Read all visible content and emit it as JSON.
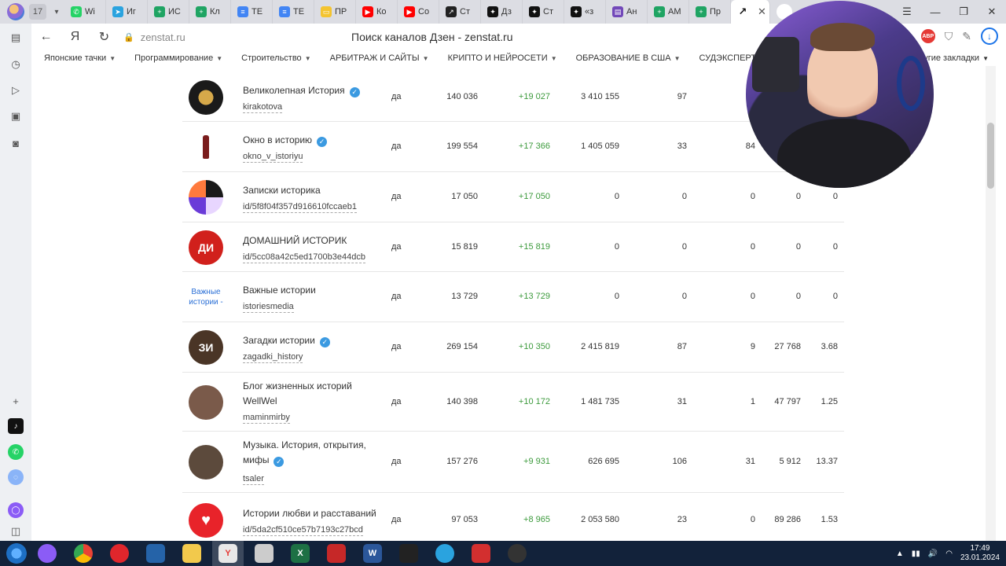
{
  "browser": {
    "tab_count": "17",
    "tabs": [
      {
        "label": "Wi",
        "icon": "whatsapp-icon",
        "color": "#25d366"
      },
      {
        "label": "Иг",
        "icon": "telegram-icon",
        "color": "#2aa3df"
      },
      {
        "label": "ИС",
        "icon": "google-sheets-icon",
        "color": "#1fa463"
      },
      {
        "label": "Кл",
        "icon": "google-sheets-icon",
        "color": "#1fa463"
      },
      {
        "label": "ТЕ",
        "icon": "google-docs-icon",
        "color": "#4285f4"
      },
      {
        "label": "ТЕ",
        "icon": "google-docs-icon",
        "color": "#4285f4"
      },
      {
        "label": "ПР",
        "icon": "folder-icon",
        "color": "#f4c430"
      },
      {
        "label": "Ко",
        "icon": "youtube-icon",
        "color": "#ff0000"
      },
      {
        "label": "Со",
        "icon": "youtube-icon",
        "color": "#ff0000"
      },
      {
        "label": "Ст",
        "icon": "zenstat-icon",
        "color": "#222222"
      },
      {
        "label": "Дз",
        "icon": "dzen-icon",
        "color": "#111111"
      },
      {
        "label": "Ст",
        "icon": "dzen-icon",
        "color": "#111111"
      },
      {
        "label": "«з",
        "icon": "dzen-icon",
        "color": "#111111"
      },
      {
        "label": "Ан",
        "icon": "forms-icon",
        "color": "#7248b9"
      },
      {
        "label": "АМ",
        "icon": "google-sheets-icon",
        "color": "#1fa463"
      },
      {
        "label": "Пр",
        "icon": "google-sheets-icon",
        "color": "#1fa463"
      }
    ],
    "active_tab_icon": "zenstat-icon",
    "url": "zenstat.ru",
    "page_title": "Поиск каналов Дзен - zenstat.ru",
    "abp_label": "ABP"
  },
  "bookmarks": {
    "items": [
      "Японские тачки",
      "Программирование",
      "Строительство",
      "АРБИТРАЖ И САЙТЫ",
      "КРИПТО И НЕЙРОСЕТИ",
      "ОБРАЗОВАНИЕ В США",
      "СУДЭКСПЕРТИЗА",
      "Всякое"
    ],
    "other": "Другие закладки"
  },
  "channels": [
    {
      "name": "Великолепная История",
      "verified": true,
      "slug": "kirakotova",
      "active": "да",
      "subs": "140 036",
      "growth": "+19 027",
      "views": "3 410 155",
      "pubs": "97",
      "f6": "",
      "f7": "",
      "f8": "",
      "avatar": {
        "icon": "double-headed-eagle-icon",
        "bg": "#1a1a1a",
        "text": ""
      }
    },
    {
      "name": "Окно в историю",
      "verified": true,
      "slug": "okno_v_istoriyu",
      "active": "да",
      "subs": "199 554",
      "growth": "+17 366",
      "views": "1 405 059",
      "pubs": "33",
      "f6": "84",
      "f7": "",
      "f8": "",
      "avatar": {
        "icon": "bottle-icon",
        "bg": "#ffffff",
        "text": ""
      }
    },
    {
      "name": "Записки историка",
      "verified": false,
      "slug": "id/5f8f04f357d916610fccaeb1",
      "active": "да",
      "subs": "17 050",
      "growth": "+17 050",
      "views": "0",
      "pubs": "0",
      "f6": "0",
      "f7": "0",
      "f8": "0",
      "avatar": {
        "icon": "abstract-avatar-icon",
        "bg": "#6a3bd8",
        "text": ""
      }
    },
    {
      "name": "ДОМАШНИЙ ИСТОРИК",
      "verified": false,
      "slug": "id/5cc08a42c5ed1700b3e44dcb",
      "active": "да",
      "subs": "15 819",
      "growth": "+15 819",
      "views": "0",
      "pubs": "0",
      "f6": "0",
      "f7": "0",
      "f8": "0",
      "avatar": {
        "icon": "di-logo-icon",
        "bg": "#d1201c",
        "text": "ДИ"
      }
    },
    {
      "name": "Важные истории",
      "verified": false,
      "slug": "istoriesmedia",
      "active": "да",
      "subs": "13 729",
      "growth": "+13 729",
      "views": "0",
      "pubs": "0",
      "f6": "0",
      "f7": "0",
      "f8": "0",
      "avatar": {
        "icon": "broken-image-icon",
        "bg": "#ffffff",
        "text": "Важные истории -"
      }
    },
    {
      "name": "Загадки истории",
      "verified": true,
      "slug": "zagadki_history",
      "active": "да",
      "subs": "269 154",
      "growth": "+10 350",
      "views": "2 415 819",
      "pubs": "87",
      "f6": "9",
      "f7": "27 768",
      "f8": "3.68",
      "avatar": {
        "icon": "zi-logo-icon",
        "bg": "#4a3526",
        "text": "ЗИ"
      }
    },
    {
      "name": "Блог жизненных историй WellWel",
      "verified": false,
      "slug": "maminmirby",
      "active": "да",
      "subs": "140 398",
      "growth": "+10 172",
      "views": "1 481 735",
      "pubs": "31",
      "f6": "1",
      "f7": "47 797",
      "f8": "1.25",
      "avatar": {
        "icon": "woman-portrait-icon",
        "bg": "#7a5a4a",
        "text": ""
      }
    },
    {
      "name": "Музыка. История, открытия, мифы",
      "verified": true,
      "slug": "tsaler",
      "active": "да",
      "subs": "157 276",
      "growth": "+9 931",
      "views": "626 695",
      "pubs": "106",
      "f6": "31",
      "f7": "5 912",
      "f8": "13.37",
      "avatar": {
        "icon": "man-portrait-icon",
        "bg": "#5c4a3c",
        "text": ""
      }
    },
    {
      "name": "Истории любви и расставаний",
      "verified": false,
      "slug": "id/5da2cf510ce57b7193c27bcd",
      "active": "да",
      "subs": "97 053",
      "growth": "+8 965",
      "views": "2 053 580",
      "pubs": "23",
      "f6": "0",
      "f7": "89 286",
      "f8": "1.53",
      "avatar": {
        "icon": "heart-pulse-icon",
        "bg": "#e8232a",
        "text": ""
      }
    }
  ],
  "taskbar": {
    "time": "17:49",
    "date": "23.01.2024",
    "apps": [
      {
        "name": "app-purple-icon",
        "color": "#8b5cf6",
        "label": ""
      },
      {
        "name": "chrome-icon",
        "color": "#34a853",
        "label": ""
      },
      {
        "name": "opera-icon",
        "color": "#e0262c",
        "label": ""
      },
      {
        "name": "monitor-app-icon",
        "color": "#2563a8",
        "label": ""
      },
      {
        "name": "explorer-icon",
        "color": "#f2c94c",
        "label": ""
      },
      {
        "name": "yandex-browser-icon",
        "color": "#e8e8e8",
        "label": "Y"
      },
      {
        "name": "calculator-icon",
        "color": "#cccccc",
        "label": ""
      },
      {
        "name": "excel-icon",
        "color": "#1d7044",
        "label": "X"
      },
      {
        "name": "red-app-icon",
        "color": "#c62828",
        "label": ""
      },
      {
        "name": "word-icon",
        "color": "#2b579a",
        "label": "W"
      },
      {
        "name": "capcut-icon",
        "color": "#222222",
        "label": ""
      },
      {
        "name": "telegram-icon",
        "color": "#2aa3df",
        "label": ""
      },
      {
        "name": "acrobat-icon",
        "color": "#d32f2f",
        "label": ""
      },
      {
        "name": "obs-icon",
        "color": "#333333",
        "label": ""
      }
    ]
  }
}
